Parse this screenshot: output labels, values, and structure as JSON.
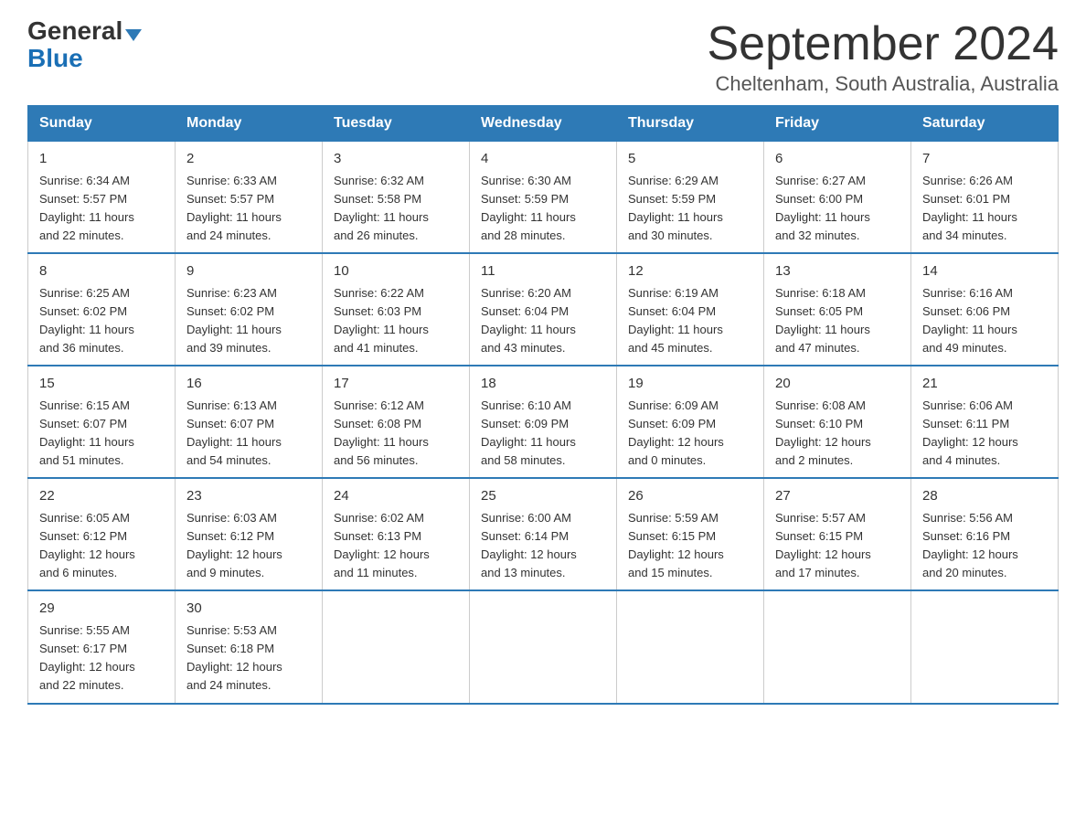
{
  "logo": {
    "general": "General",
    "triangle_symbol": "▶",
    "blue": "Blue"
  },
  "header": {
    "month_title": "September 2024",
    "location": "Cheltenham, South Australia, Australia"
  },
  "weekdays": [
    "Sunday",
    "Monday",
    "Tuesday",
    "Wednesday",
    "Thursday",
    "Friday",
    "Saturday"
  ],
  "weeks": [
    [
      {
        "day": "1",
        "info": "Sunrise: 6:34 AM\nSunset: 5:57 PM\nDaylight: 11 hours\nand 22 minutes."
      },
      {
        "day": "2",
        "info": "Sunrise: 6:33 AM\nSunset: 5:57 PM\nDaylight: 11 hours\nand 24 minutes."
      },
      {
        "day": "3",
        "info": "Sunrise: 6:32 AM\nSunset: 5:58 PM\nDaylight: 11 hours\nand 26 minutes."
      },
      {
        "day": "4",
        "info": "Sunrise: 6:30 AM\nSunset: 5:59 PM\nDaylight: 11 hours\nand 28 minutes."
      },
      {
        "day": "5",
        "info": "Sunrise: 6:29 AM\nSunset: 5:59 PM\nDaylight: 11 hours\nand 30 minutes."
      },
      {
        "day": "6",
        "info": "Sunrise: 6:27 AM\nSunset: 6:00 PM\nDaylight: 11 hours\nand 32 minutes."
      },
      {
        "day": "7",
        "info": "Sunrise: 6:26 AM\nSunset: 6:01 PM\nDaylight: 11 hours\nand 34 minutes."
      }
    ],
    [
      {
        "day": "8",
        "info": "Sunrise: 6:25 AM\nSunset: 6:02 PM\nDaylight: 11 hours\nand 36 minutes."
      },
      {
        "day": "9",
        "info": "Sunrise: 6:23 AM\nSunset: 6:02 PM\nDaylight: 11 hours\nand 39 minutes."
      },
      {
        "day": "10",
        "info": "Sunrise: 6:22 AM\nSunset: 6:03 PM\nDaylight: 11 hours\nand 41 minutes."
      },
      {
        "day": "11",
        "info": "Sunrise: 6:20 AM\nSunset: 6:04 PM\nDaylight: 11 hours\nand 43 minutes."
      },
      {
        "day": "12",
        "info": "Sunrise: 6:19 AM\nSunset: 6:04 PM\nDaylight: 11 hours\nand 45 minutes."
      },
      {
        "day": "13",
        "info": "Sunrise: 6:18 AM\nSunset: 6:05 PM\nDaylight: 11 hours\nand 47 minutes."
      },
      {
        "day": "14",
        "info": "Sunrise: 6:16 AM\nSunset: 6:06 PM\nDaylight: 11 hours\nand 49 minutes."
      }
    ],
    [
      {
        "day": "15",
        "info": "Sunrise: 6:15 AM\nSunset: 6:07 PM\nDaylight: 11 hours\nand 51 minutes."
      },
      {
        "day": "16",
        "info": "Sunrise: 6:13 AM\nSunset: 6:07 PM\nDaylight: 11 hours\nand 54 minutes."
      },
      {
        "day": "17",
        "info": "Sunrise: 6:12 AM\nSunset: 6:08 PM\nDaylight: 11 hours\nand 56 minutes."
      },
      {
        "day": "18",
        "info": "Sunrise: 6:10 AM\nSunset: 6:09 PM\nDaylight: 11 hours\nand 58 minutes."
      },
      {
        "day": "19",
        "info": "Sunrise: 6:09 AM\nSunset: 6:09 PM\nDaylight: 12 hours\nand 0 minutes."
      },
      {
        "day": "20",
        "info": "Sunrise: 6:08 AM\nSunset: 6:10 PM\nDaylight: 12 hours\nand 2 minutes."
      },
      {
        "day": "21",
        "info": "Sunrise: 6:06 AM\nSunset: 6:11 PM\nDaylight: 12 hours\nand 4 minutes."
      }
    ],
    [
      {
        "day": "22",
        "info": "Sunrise: 6:05 AM\nSunset: 6:12 PM\nDaylight: 12 hours\nand 6 minutes."
      },
      {
        "day": "23",
        "info": "Sunrise: 6:03 AM\nSunset: 6:12 PM\nDaylight: 12 hours\nand 9 minutes."
      },
      {
        "day": "24",
        "info": "Sunrise: 6:02 AM\nSunset: 6:13 PM\nDaylight: 12 hours\nand 11 minutes."
      },
      {
        "day": "25",
        "info": "Sunrise: 6:00 AM\nSunset: 6:14 PM\nDaylight: 12 hours\nand 13 minutes."
      },
      {
        "day": "26",
        "info": "Sunrise: 5:59 AM\nSunset: 6:15 PM\nDaylight: 12 hours\nand 15 minutes."
      },
      {
        "day": "27",
        "info": "Sunrise: 5:57 AM\nSunset: 6:15 PM\nDaylight: 12 hours\nand 17 minutes."
      },
      {
        "day": "28",
        "info": "Sunrise: 5:56 AM\nSunset: 6:16 PM\nDaylight: 12 hours\nand 20 minutes."
      }
    ],
    [
      {
        "day": "29",
        "info": "Sunrise: 5:55 AM\nSunset: 6:17 PM\nDaylight: 12 hours\nand 22 minutes."
      },
      {
        "day": "30",
        "info": "Sunrise: 5:53 AM\nSunset: 6:18 PM\nDaylight: 12 hours\nand 24 minutes."
      },
      {
        "day": "",
        "info": ""
      },
      {
        "day": "",
        "info": ""
      },
      {
        "day": "",
        "info": ""
      },
      {
        "day": "",
        "info": ""
      },
      {
        "day": "",
        "info": ""
      }
    ]
  ]
}
